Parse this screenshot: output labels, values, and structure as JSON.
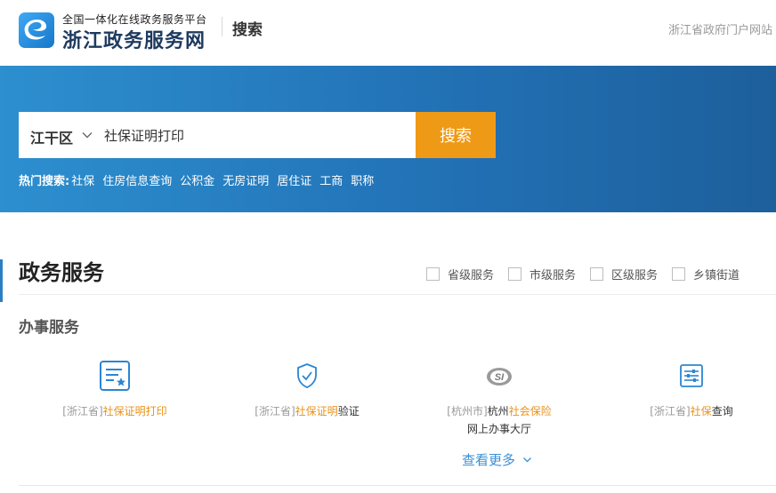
{
  "header": {
    "platform_subtitle": "全国一体化在线政务服务平台",
    "site_title": "浙江政务服务网",
    "page_label": "搜索",
    "portal_link": "浙江省政府门户网站"
  },
  "search": {
    "region": "江干区",
    "query": "社保证明打印",
    "button_label": "搜索",
    "hot_label": "热门搜索:",
    "hot_terms": [
      "社保",
      "住房信息查询",
      "公积金",
      "无房证明",
      "居住证",
      "工商",
      "职称"
    ]
  },
  "gov_services": {
    "title": "政务服务",
    "filters": [
      "省级服务",
      "市级服务",
      "区级服务",
      "乡镇街道"
    ],
    "subsection_title": "办事服务",
    "items": [
      {
        "prefix": "[浙江省]",
        "highlight": "社保证明打印",
        "suffix": "",
        "line2": "",
        "icon": "document-star-icon"
      },
      {
        "prefix": "[浙江省]",
        "highlight": "社保证明",
        "suffix": "验证",
        "line2": "",
        "icon": "shield-check-icon"
      },
      {
        "prefix": "[杭州市]",
        "plain": "杭州",
        "highlight": "社会保险",
        "suffix": "",
        "line2": "网上办事大厅",
        "icon": "social-insurance-logo-icon"
      },
      {
        "prefix": "[浙江省]",
        "highlight": "社保",
        "suffix": "查询",
        "line2": "",
        "icon": "list-settings-icon"
      }
    ],
    "more_label": "查看更多"
  },
  "colors": {
    "banner_blue": "#2272b6",
    "search_button_orange": "#ef9a16",
    "highlight_orange": "#e8921b",
    "link_blue": "#3a8fd6"
  }
}
